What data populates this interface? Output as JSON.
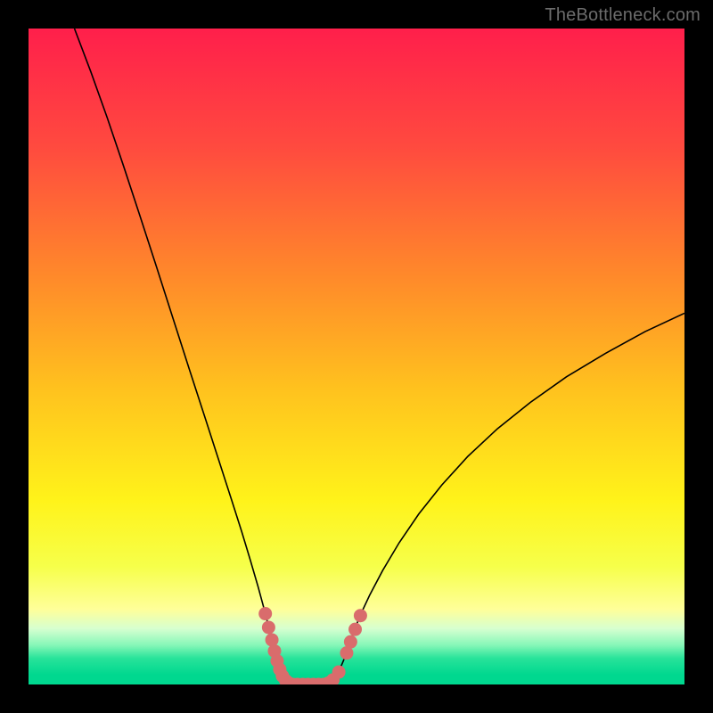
{
  "watermark": "TheBottleneck.com",
  "chart_data": {
    "type": "line",
    "title": "",
    "xlabel": "",
    "ylabel": "",
    "xlim": [
      0,
      100
    ],
    "ylim": [
      0,
      100
    ],
    "grid": false,
    "legend": false,
    "background_gradient_stops": [
      {
        "offset": 0.0,
        "color": "#ff1f4b"
      },
      {
        "offset": 0.18,
        "color": "#ff4a3f"
      },
      {
        "offset": 0.38,
        "color": "#ff8a2a"
      },
      {
        "offset": 0.55,
        "color": "#ffc21e"
      },
      {
        "offset": 0.72,
        "color": "#fff31a"
      },
      {
        "offset": 0.82,
        "color": "#f6ff4a"
      },
      {
        "offset": 0.885,
        "color": "#ffff99"
      },
      {
        "offset": 0.915,
        "color": "#d6ffd0"
      },
      {
        "offset": 0.94,
        "color": "#86f7b8"
      },
      {
        "offset": 0.96,
        "color": "#28e39a"
      },
      {
        "offset": 0.985,
        "color": "#00d88f"
      },
      {
        "offset": 1.0,
        "color": "#00d88f"
      }
    ],
    "series": [
      {
        "name": "curve",
        "style": "thin-black",
        "points": [
          {
            "x": 7.0,
            "y": 100.0
          },
          {
            "x": 9.5,
            "y": 93.4
          },
          {
            "x": 12.0,
            "y": 86.4
          },
          {
            "x": 14.5,
            "y": 79.0
          },
          {
            "x": 17.0,
            "y": 71.4
          },
          {
            "x": 19.5,
            "y": 63.7
          },
          {
            "x": 22.0,
            "y": 55.9
          },
          {
            "x": 24.5,
            "y": 48.1
          },
          {
            "x": 27.0,
            "y": 40.4
          },
          {
            "x": 29.0,
            "y": 34.2
          },
          {
            "x": 31.0,
            "y": 28.0
          },
          {
            "x": 32.5,
            "y": 23.3
          },
          {
            "x": 33.8,
            "y": 19.0
          },
          {
            "x": 35.0,
            "y": 14.9
          },
          {
            "x": 36.0,
            "y": 11.2
          },
          {
            "x": 36.8,
            "y": 8.0
          },
          {
            "x": 37.4,
            "y": 5.4
          },
          {
            "x": 37.9,
            "y": 3.4
          },
          {
            "x": 38.3,
            "y": 2.0
          },
          {
            "x": 38.7,
            "y": 1.1
          },
          {
            "x": 39.2,
            "y": 0.5
          },
          {
            "x": 39.8,
            "y": 0.2
          },
          {
            "x": 40.5,
            "y": 0.0
          },
          {
            "x": 41.4,
            "y": 0.0
          },
          {
            "x": 42.4,
            "y": 0.0
          },
          {
            "x": 43.4,
            "y": 0.0
          },
          {
            "x": 44.4,
            "y": 0.0
          },
          {
            "x": 45.3,
            "y": 0.1
          },
          {
            "x": 46.1,
            "y": 0.5
          },
          {
            "x": 46.8,
            "y": 1.2
          },
          {
            "x": 47.4,
            "y": 2.2
          },
          {
            "x": 48.0,
            "y": 3.6
          },
          {
            "x": 48.7,
            "y": 5.5
          },
          {
            "x": 49.5,
            "y": 7.8
          },
          {
            "x": 50.5,
            "y": 10.4
          },
          {
            "x": 52.0,
            "y": 13.6
          },
          {
            "x": 54.0,
            "y": 17.4
          },
          {
            "x": 56.5,
            "y": 21.6
          },
          {
            "x": 59.5,
            "y": 26.0
          },
          {
            "x": 63.0,
            "y": 30.4
          },
          {
            "x": 67.0,
            "y": 34.8
          },
          {
            "x": 71.5,
            "y": 39.0
          },
          {
            "x": 76.5,
            "y": 43.0
          },
          {
            "x": 82.0,
            "y": 46.9
          },
          {
            "x": 88.0,
            "y": 50.5
          },
          {
            "x": 94.0,
            "y": 53.8
          },
          {
            "x": 100.0,
            "y": 56.6
          }
        ]
      },
      {
        "name": "valley-markers",
        "style": "salmon-dots",
        "color": "#d96c6c",
        "points": [
          {
            "x": 36.1,
            "y": 10.8
          },
          {
            "x": 36.6,
            "y": 8.7
          },
          {
            "x": 37.1,
            "y": 6.8
          },
          {
            "x": 37.5,
            "y": 5.1
          },
          {
            "x": 37.9,
            "y": 3.6
          },
          {
            "x": 38.3,
            "y": 2.3
          },
          {
            "x": 38.7,
            "y": 1.3
          },
          {
            "x": 39.2,
            "y": 0.6
          },
          {
            "x": 39.7,
            "y": 0.2
          },
          {
            "x": 40.3,
            "y": 0.0
          },
          {
            "x": 41.0,
            "y": 0.0
          },
          {
            "x": 41.8,
            "y": 0.0
          },
          {
            "x": 42.6,
            "y": 0.0
          },
          {
            "x": 43.4,
            "y": 0.0
          },
          {
            "x": 44.2,
            "y": 0.0
          },
          {
            "x": 45.0,
            "y": 0.0
          },
          {
            "x": 45.7,
            "y": 0.2
          },
          {
            "x": 46.4,
            "y": 0.7
          },
          {
            "x": 47.3,
            "y": 1.9
          },
          {
            "x": 48.5,
            "y": 4.8
          },
          {
            "x": 49.1,
            "y": 6.5
          },
          {
            "x": 49.8,
            "y": 8.4
          },
          {
            "x": 50.6,
            "y": 10.5
          }
        ]
      }
    ]
  }
}
